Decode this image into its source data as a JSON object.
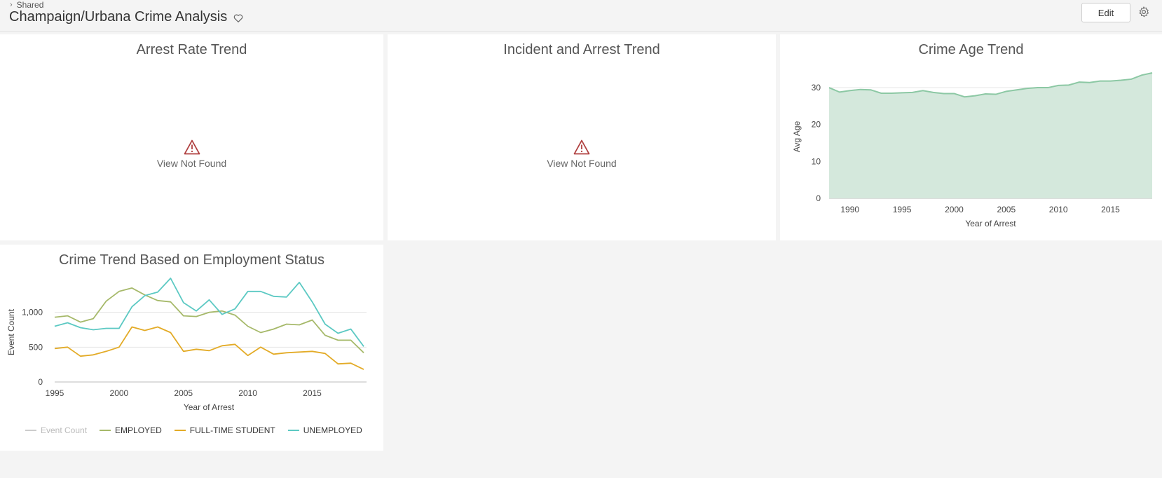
{
  "header": {
    "breadcrumb": "Shared",
    "title": "Champaign/Urbana Crime Analysis",
    "edit_label": "Edit"
  },
  "tiles": {
    "arrest_rate": {
      "title": "Arrest Rate Trend",
      "message": "View Not Found"
    },
    "incident_arrest": {
      "title": "Incident and Arrest Trend",
      "message": "View Not Found"
    },
    "crime_age": {
      "title": "Crime Age Trend"
    },
    "employment": {
      "title": "Crime Trend Based on Employment Status"
    }
  },
  "colors": {
    "area_fill": "#d4e8dc",
    "area_line": "#8cc8a4",
    "employed": "#a6b96a",
    "student": "#e3ab27",
    "unemployed": "#5cc9c3",
    "event_count": "#cccccc",
    "warning": "#b04040"
  },
  "chart_data": [
    {
      "type": "area",
      "title": "Crime Age Trend",
      "xlabel": "Year of Arrest",
      "ylabel": "Avg Age",
      "x": [
        1988,
        1989,
        1990,
        1991,
        1992,
        1993,
        1994,
        1995,
        1996,
        1997,
        1998,
        1999,
        2000,
        2001,
        2002,
        2003,
        2004,
        2005,
        2006,
        2007,
        2008,
        2009,
        2010,
        2011,
        2012,
        2013,
        2014,
        2015,
        2016,
        2017,
        2018,
        2019
      ],
      "values": [
        30,
        28.8,
        29.2,
        29.5,
        29.4,
        28.5,
        28.5,
        28.6,
        28.7,
        29.2,
        28.7,
        28.4,
        28.4,
        27.5,
        27.8,
        28.3,
        28.2,
        29.0,
        29.4,
        29.8,
        30.0,
        30.0,
        30.6,
        30.7,
        31.5,
        31.4,
        31.8,
        31.8,
        32.0,
        32.3,
        33.4,
        34.0
      ],
      "xticks": [
        1990,
        1995,
        2000,
        2005,
        2010,
        2015
      ],
      "yticks": [
        0,
        10,
        20,
        30
      ],
      "xlim": [
        1988,
        2019
      ],
      "ylim": [
        0,
        34
      ],
      "grid": true
    },
    {
      "type": "line",
      "title": "Crime Trend Based on Employment Status",
      "xlabel": "Year of Arrest",
      "ylabel": "Event Count",
      "x": [
        1995,
        1996,
        1997,
        1998,
        1999,
        2000,
        2001,
        2002,
        2003,
        2004,
        2005,
        2006,
        2007,
        2008,
        2009,
        2010,
        2011,
        2012,
        2013,
        2014,
        2015,
        2016,
        2017,
        2018,
        2019
      ],
      "series": [
        {
          "name": "EMPLOYED",
          "values": [
            930,
            950,
            860,
            910,
            1160,
            1300,
            1350,
            1250,
            1170,
            1150,
            950,
            940,
            1000,
            1020,
            960,
            800,
            710,
            760,
            830,
            820,
            890,
            670,
            600,
            600,
            420
          ]
        },
        {
          "name": "FULL-TIME STUDENT",
          "values": [
            480,
            500,
            370,
            390,
            440,
            500,
            790,
            740,
            790,
            710,
            440,
            470,
            450,
            520,
            540,
            380,
            500,
            400,
            420,
            430,
            440,
            410,
            260,
            270,
            180
          ]
        },
        {
          "name": "UNEMPLOYED",
          "values": [
            800,
            850,
            780,
            750,
            770,
            770,
            1080,
            1240,
            1290,
            1490,
            1140,
            1020,
            1180,
            970,
            1050,
            1300,
            1300,
            1230,
            1220,
            1430,
            1150,
            830,
            700,
            760,
            510
          ]
        }
      ],
      "legend": [
        "Event Count",
        "EMPLOYED",
        "FULL-TIME STUDENT",
        "UNEMPLOYED"
      ],
      "xticks": [
        1995,
        2000,
        2005,
        2010,
        2015
      ],
      "yticks": [
        0,
        500,
        1000
      ],
      "ytick_labels": [
        "0",
        "500",
        "1,000"
      ],
      "xlim": [
        1995,
        2019
      ],
      "ylim": [
        0,
        1550
      ],
      "grid": true,
      "legend_position": "bottom"
    }
  ]
}
